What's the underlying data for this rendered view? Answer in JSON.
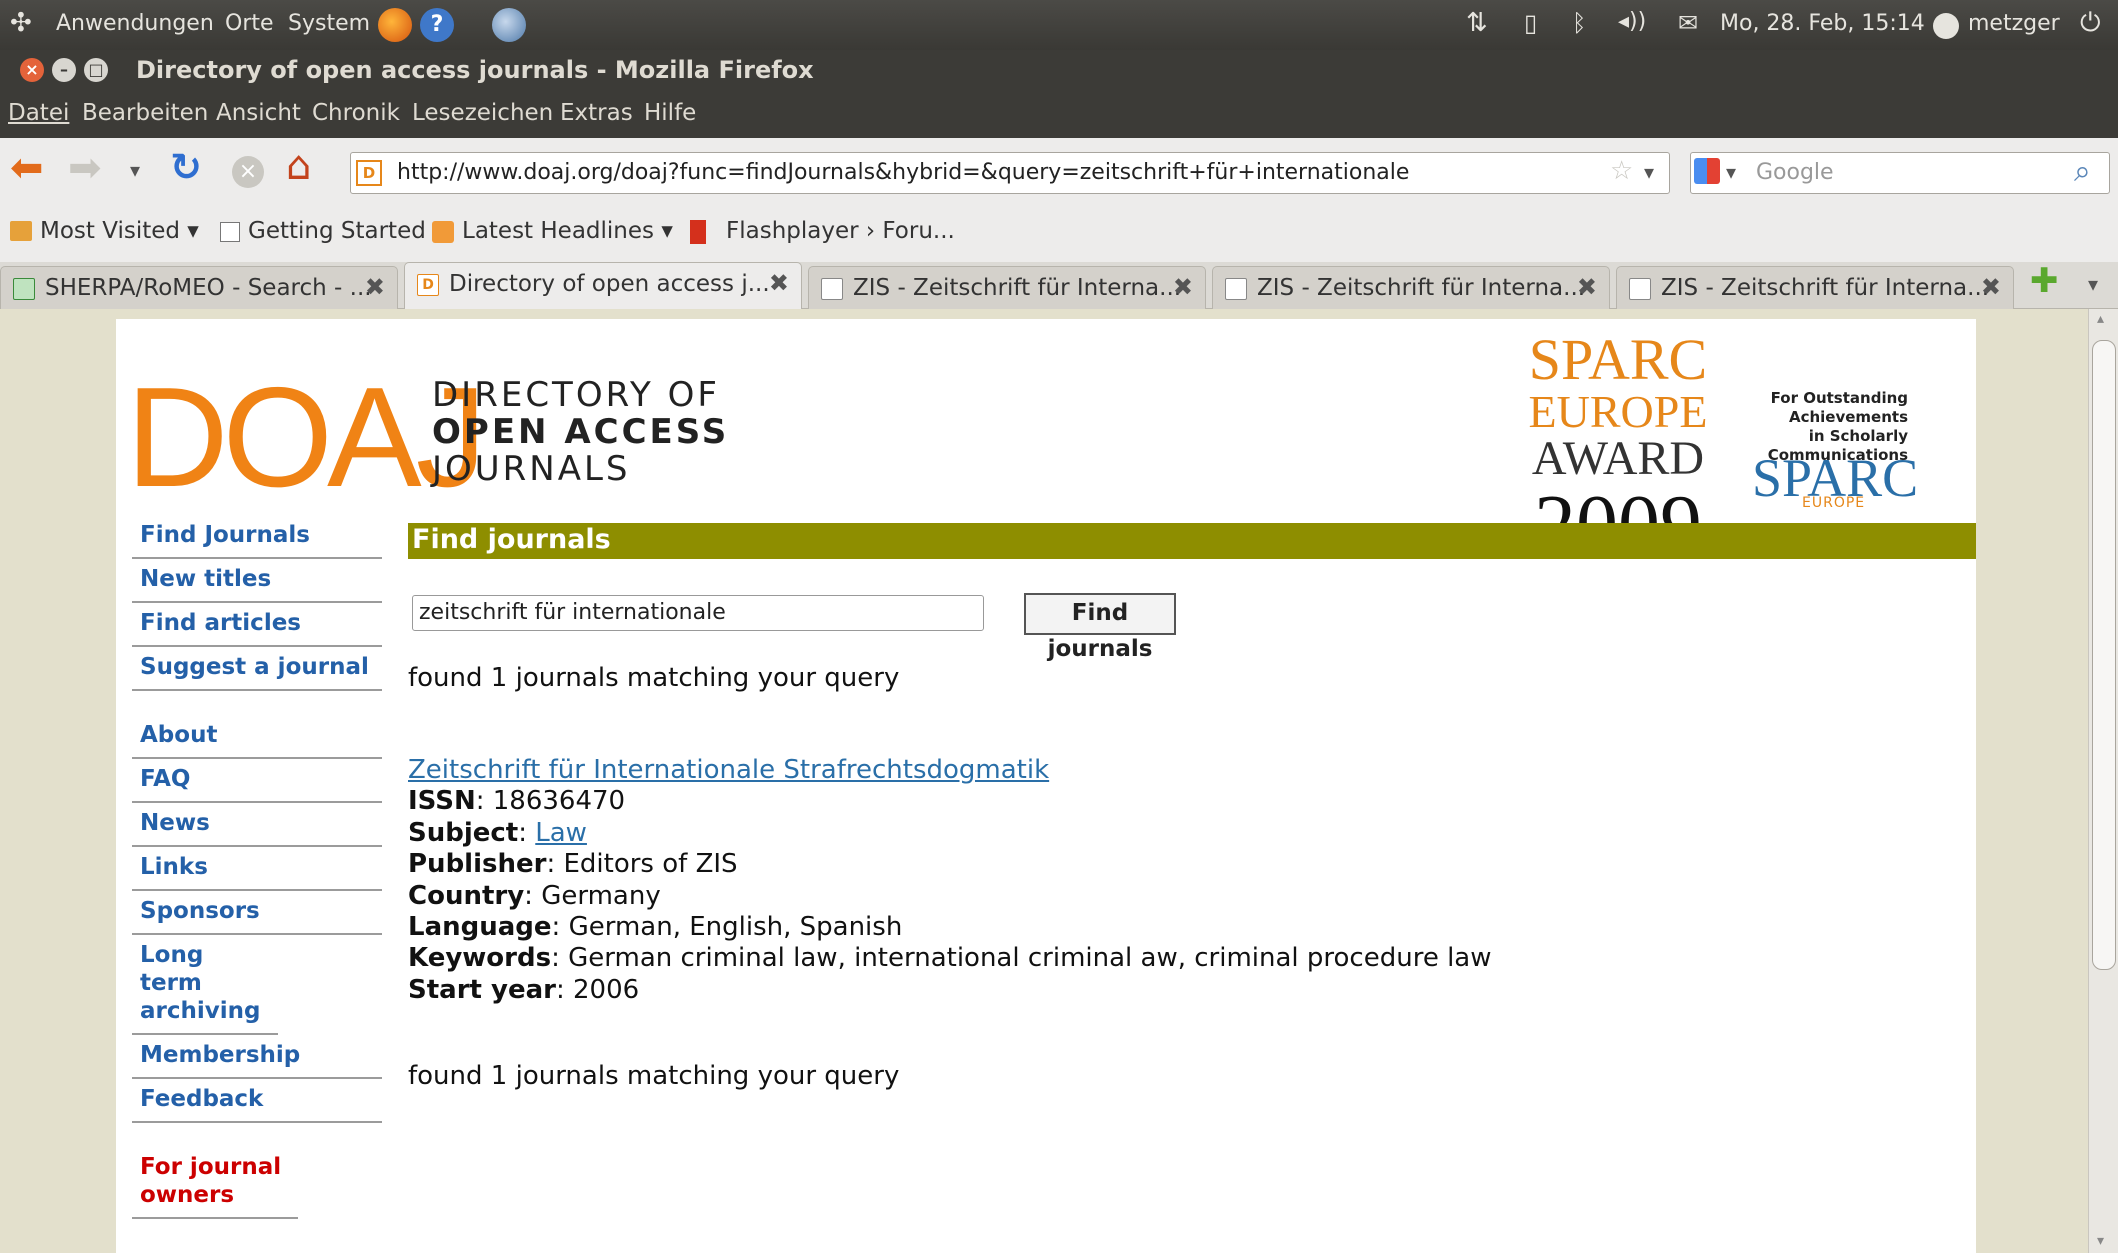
{
  "panel": {
    "menus": [
      "Anwendungen",
      "Orte",
      "System"
    ],
    "datetime": "Mo, 28. Feb, 15:14",
    "user": "metzger"
  },
  "window": {
    "title": "Directory of open access journals - Mozilla Firefox"
  },
  "menubar": [
    "Datei",
    "Bearbeiten",
    "Ansicht",
    "Chronik",
    "Lesezeichen",
    "Extras",
    "Hilfe"
  ],
  "toolbar": {
    "url": "http://www.doaj.org/doaj?func=findJournals&hybrid=&query=zeitschrift+für+internationale",
    "search_placeholder": "Google"
  },
  "bookmarks": [
    "Most Visited ▾",
    "Getting Started",
    "Latest Headlines ▾",
    "Flashplayer › Foru..."
  ],
  "tabs": [
    "SHERPA/RoMEO - Search - ...",
    "Directory of open access j...",
    "ZIS - Zeitschrift für Interna...",
    "ZIS - Zeitschrift für Interna...",
    "ZIS - Zeitschrift für Interna..."
  ],
  "logo": {
    "mark": "DOAJ",
    "sub1": "DIRECTORY OF",
    "sub2": "OPEN ACCESS",
    "sub3": "JOURNALS"
  },
  "award": {
    "l1": "SPARC",
    "l2": "EUROPE",
    "l3": "AWARD",
    "year": "2009",
    "tag1": "For Outstanding",
    "tag2": "Achievements",
    "tag3": "in Scholarly",
    "tag4": "Communications",
    "brand": "SPARC",
    "brand_sub": "EUROPE"
  },
  "nav": {
    "items": [
      "Find Journals",
      "New titles",
      "Find articles",
      "Suggest a journal"
    ],
    "items2": [
      "About",
      "FAQ",
      "News",
      "Links",
      "Sponsors",
      "Long term archiving",
      "Membership",
      "Feedback"
    ],
    "owners": "For journal owners"
  },
  "main": {
    "header": "Find journals",
    "query": "zeitschrift für internationale",
    "button": "Find journals",
    "found_top": "found 1 journals matching your query",
    "found_bottom": "found 1 journals matching your query",
    "result": {
      "title": "Zeitschrift für Internationale Strafrechtsdogmatik",
      "issn_label": "ISSN",
      "issn": "18636470",
      "subject_label": "Subject",
      "subject": "Law",
      "publisher_label": "Publisher",
      "publisher": "Editors of ZIS",
      "country_label": "Country",
      "country": "Germany",
      "language_label": "Language",
      "language": "German, English, Spanish",
      "keywords_label": "Keywords",
      "keywords": "German criminal law, international criminal aw, criminal procedure law",
      "start_label": "Start year",
      "start": "2006"
    }
  }
}
